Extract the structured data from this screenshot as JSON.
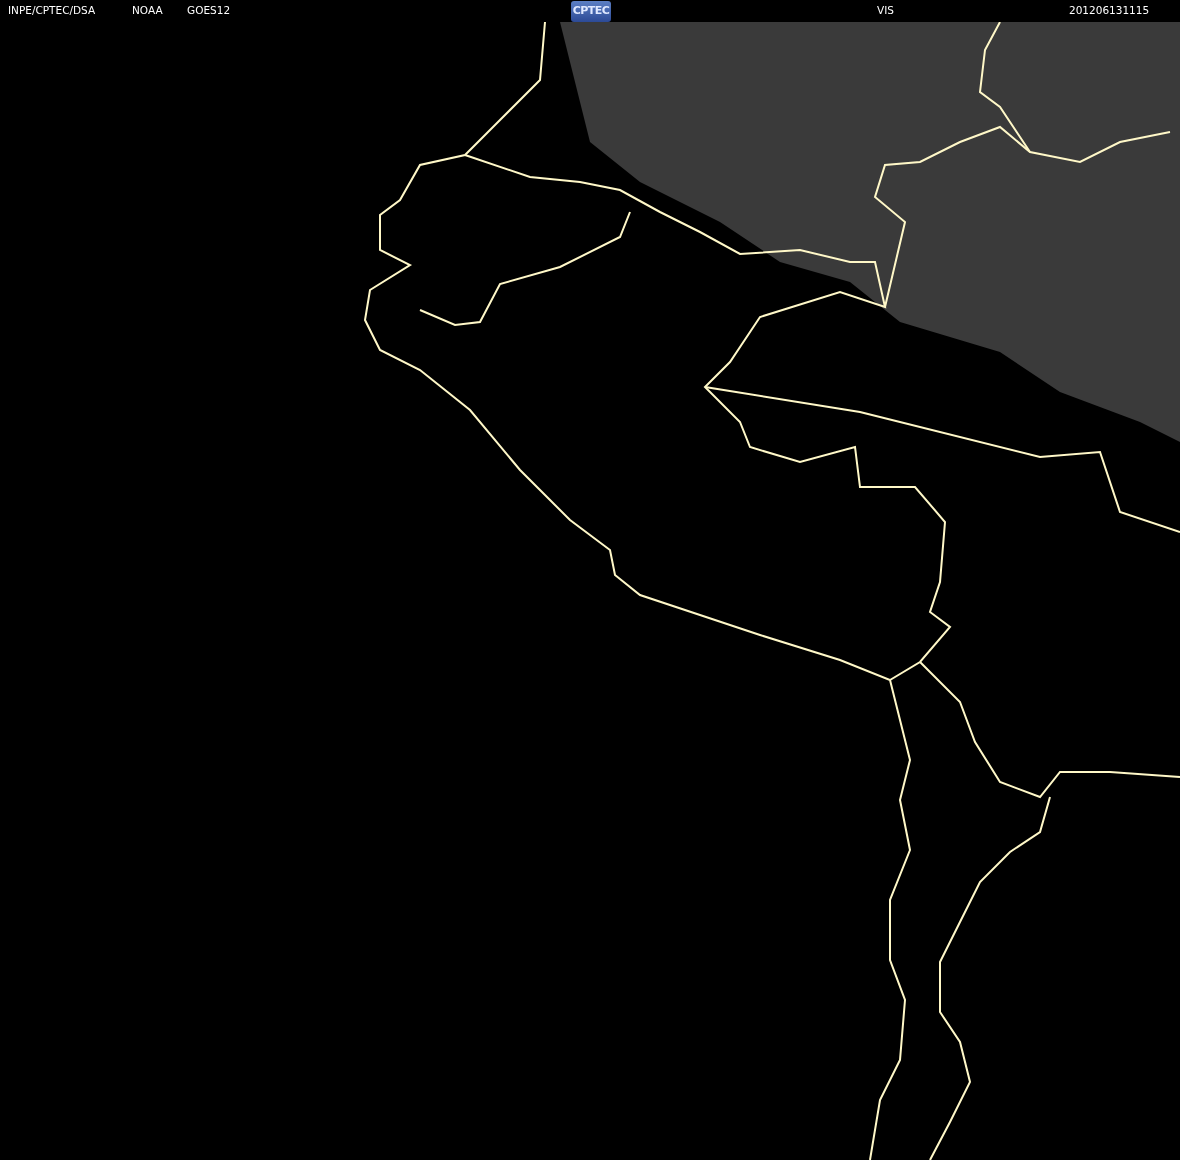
{
  "header": {
    "source": "INPE/CPTEC/DSA",
    "agency": "NOAA",
    "satellite": "GOES12",
    "logo": "CPTEC",
    "channel": "VIS",
    "timestamp": "201206131115"
  }
}
